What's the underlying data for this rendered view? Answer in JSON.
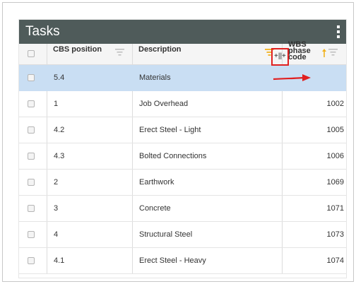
{
  "panel": {
    "title": "Tasks",
    "menu_icon": "more-vertical-icon"
  },
  "columns": {
    "position": "CBS position",
    "description": "Description",
    "wbs": "WBS phase code"
  },
  "wbs_header_lines": [
    "WBS",
    "phase",
    "code"
  ],
  "icons": {
    "filter": "filter-icon",
    "sort": "sort-ascending-icon",
    "resize": "column-resize-cursor-icon"
  },
  "colors": {
    "header_bar": "#4f5b5a",
    "selected_row": "#c9def3",
    "annotation": "#e02020",
    "active_filter": "#f2b21f"
  },
  "rows": [
    {
      "position": "5.4",
      "description": "Materials",
      "wbs": "",
      "selected": true
    },
    {
      "position": "1",
      "description": "Job Overhead",
      "wbs": "1002"
    },
    {
      "position": "4.2",
      "description": "Erect Steel - Light",
      "wbs": "1005"
    },
    {
      "position": "4.3",
      "description": "Bolted Connections",
      "wbs": "1006"
    },
    {
      "position": "2",
      "description": "Earthwork",
      "wbs": "1069"
    },
    {
      "position": "3",
      "description": "Concrete",
      "wbs": "1071"
    },
    {
      "position": "4",
      "description": "Structural Steel",
      "wbs": "1073"
    },
    {
      "position": "4.1",
      "description": "Erect Steel - Heavy",
      "wbs": "1074"
    }
  ]
}
